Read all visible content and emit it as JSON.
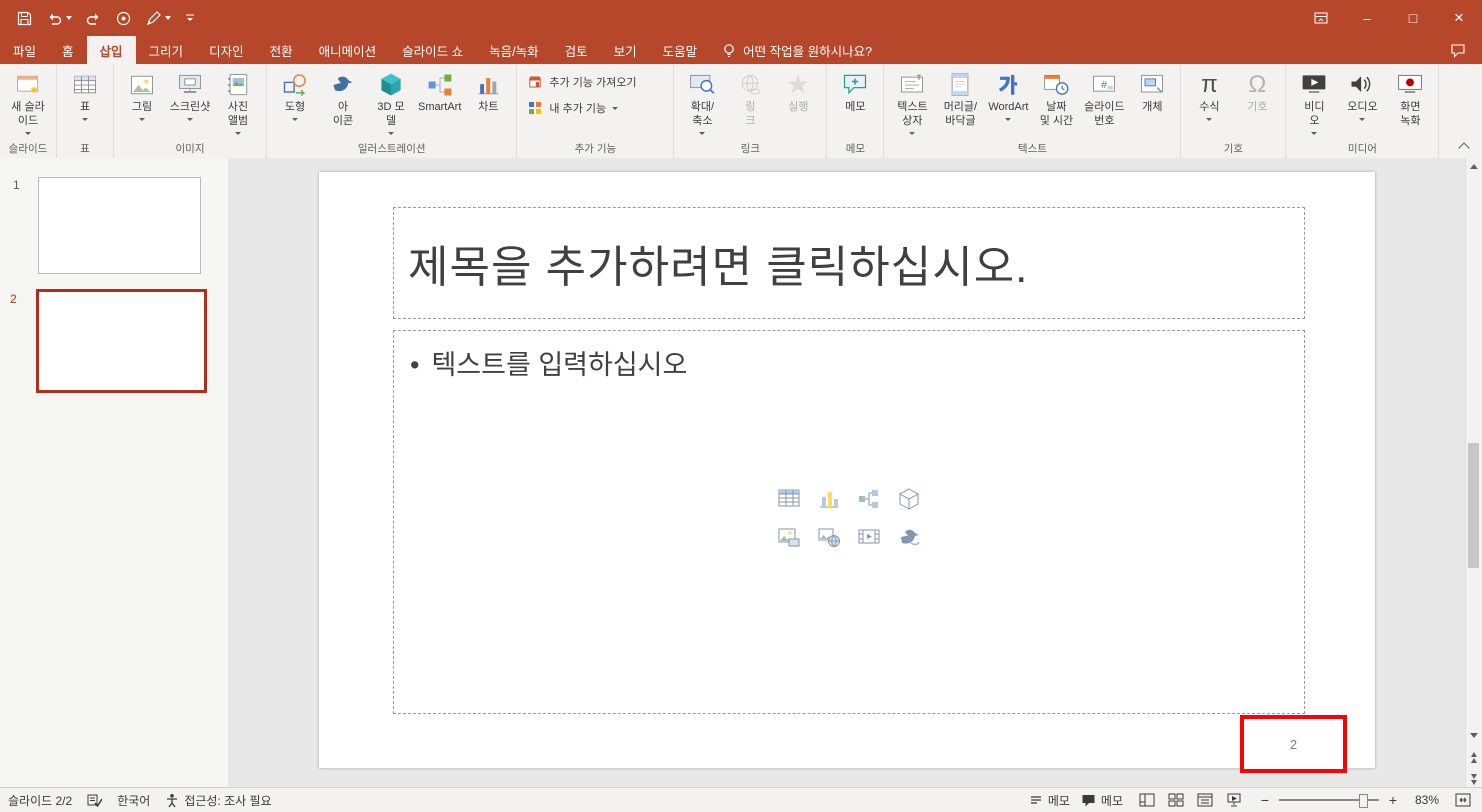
{
  "colors": {
    "brand": "#B7472A",
    "thumbnail_selection": "#B02E1A",
    "annotation": "#FF0000",
    "ribbon_bg": "#F3F2F1",
    "slide_area_bg": "#E8E8E8"
  },
  "window": {
    "minimize": "–",
    "maximize": "□",
    "close": "×"
  },
  "tabs": {
    "items": [
      {
        "label": "파일"
      },
      {
        "label": "홈"
      },
      {
        "label": "삽입",
        "active": true
      },
      {
        "label": "그리기"
      },
      {
        "label": "디자인"
      },
      {
        "label": "전환"
      },
      {
        "label": "애니메이션"
      },
      {
        "label": "슬라이드 쇼"
      },
      {
        "label": "녹음/녹화"
      },
      {
        "label": "검토"
      },
      {
        "label": "보기"
      },
      {
        "label": "도움말"
      }
    ],
    "tellme": "어떤 작업을 원하시나요?"
  },
  "ribbon": {
    "groups": [
      {
        "label": "슬라이드",
        "buttons": [
          {
            "label": "새 슬라\n이드"
          }
        ]
      },
      {
        "label": "표",
        "buttons": [
          {
            "label": "표"
          }
        ]
      },
      {
        "label": "이미지",
        "buttons": [
          {
            "label": "그림"
          },
          {
            "label": "스크린샷"
          },
          {
            "label": "사진\n앨범"
          }
        ]
      },
      {
        "label": "일러스트레이션",
        "buttons": [
          {
            "label": "도형"
          },
          {
            "label": "아\n이콘"
          },
          {
            "label": "3D 모\n델"
          },
          {
            "label": "SmartArt"
          },
          {
            "label": "차트"
          }
        ]
      },
      {
        "label": "추가 기능",
        "buttons": [
          {
            "label": "추가 기능 가져오기"
          },
          {
            "label": "내 추가 기능"
          }
        ]
      },
      {
        "label": "링크",
        "buttons": [
          {
            "label": "확대/\n축소"
          },
          {
            "label": "링\n크"
          },
          {
            "label": "실행"
          }
        ]
      },
      {
        "label": "메모",
        "buttons": [
          {
            "label": "메모"
          }
        ]
      },
      {
        "label": "텍스트",
        "buttons": [
          {
            "label": "텍스트\n상자"
          },
          {
            "label": "머리글/\n바닥글"
          },
          {
            "label": "WordArt"
          },
          {
            "label": "날짜\n및 시간"
          },
          {
            "label": "슬라이드\n번호"
          },
          {
            "label": "개체"
          }
        ]
      },
      {
        "label": "기호",
        "buttons": [
          {
            "label": "수식"
          },
          {
            "label": "기호"
          }
        ]
      },
      {
        "label": "미디어",
        "buttons": [
          {
            "label": "비디\n오"
          },
          {
            "label": "오디오"
          },
          {
            "label": "화면\n녹화"
          }
        ]
      }
    ]
  },
  "symbols": {
    "equation": "π",
    "symbol": "Ω"
  },
  "thumbnails": {
    "items": [
      {
        "number": "1"
      },
      {
        "number": "2"
      }
    ]
  },
  "slide": {
    "title_placeholder": "제목을 추가하려면 클릭하십시오.",
    "bullet": "•",
    "body_placeholder": "텍스트를 입력하십시오",
    "page_number": "2"
  },
  "statusbar": {
    "slide_indicator": "슬라이드 2/2",
    "language": "한국어",
    "accessibility": "접근성: 조사 필요",
    "notes_label": "메모",
    "comments_label": "메모",
    "zoom_out": "−",
    "zoom_in": "+",
    "zoom_level": "83%"
  }
}
